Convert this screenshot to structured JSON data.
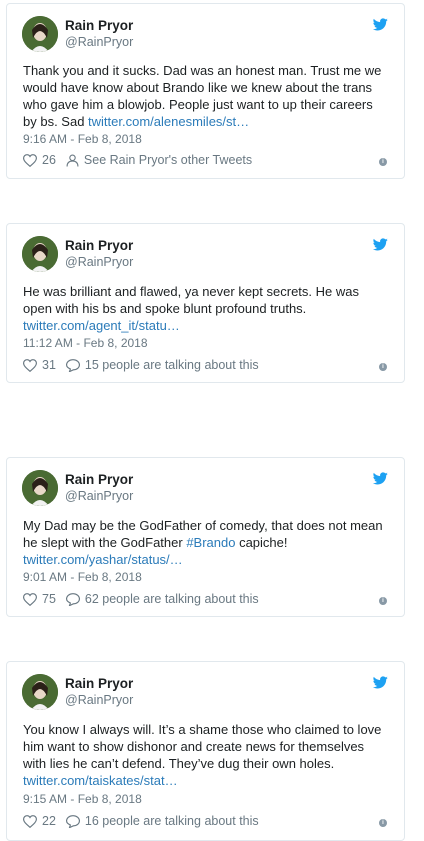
{
  "tweets": [
    {
      "name": "Rain Pryor",
      "handle": "@RainPryor",
      "text_before": "Thank you and it sucks. Dad was an honest man. Trust me we would have know about Brando like we knew about the trans who gave him a blowjob. People just want to up their careers by bs. Sad ",
      "hashtag": "",
      "text_after": "",
      "link": "twitter.com/alenesmiles/st…",
      "time": "9:16 AM - Feb 8, 2018",
      "likes": "26",
      "action_label": "See Rain Pryor's other Tweets",
      "action_icon": "person-icon"
    },
    {
      "name": "Rain Pryor",
      "handle": "@RainPryor",
      "text_before": "He was brilliant and flawed, ya never kept secrets. He was open with his bs and spoke blunt profound truths.",
      "hashtag": "",
      "text_after": "",
      "link": "twitter.com/agent_it/statu…",
      "time": "11:12 AM - Feb 8, 2018",
      "likes": "31",
      "action_label": "15 people are talking about this",
      "action_icon": "reply-bubble-icon"
    },
    {
      "name": "Rain Pryor",
      "handle": "@RainPryor",
      "text_before": "My Dad may be the GodFather of comedy, that does not mean he slept with the GodFather ",
      "hashtag": "#Brando",
      "text_after": " capiche!",
      "link": "twitter.com/yashar/status/…",
      "time": "9:01 AM - Feb 8, 2018",
      "likes": "75",
      "action_label": "62 people are talking about this",
      "action_icon": "reply-bubble-icon"
    },
    {
      "name": "Rain Pryor",
      "handle": "@RainPryor",
      "text_before": "You know I always will. It’s a shame those who claimed to love him want to show dishonor and create news for themselves with lies he can’t defend. They’ve dug their own holes.",
      "hashtag": "",
      "text_after": "",
      "link": "twitter.com/taiskates/stat…",
      "time": "9:15 AM - Feb 8, 2018",
      "likes": "22",
      "action_label": "16 people are talking about this",
      "action_icon": "reply-bubble-icon"
    }
  ],
  "colors": {
    "link": "#2b7bb9",
    "twitter_blue": "#1da1f2",
    "muted": "#697882",
    "border": "#e1e8ed"
  }
}
